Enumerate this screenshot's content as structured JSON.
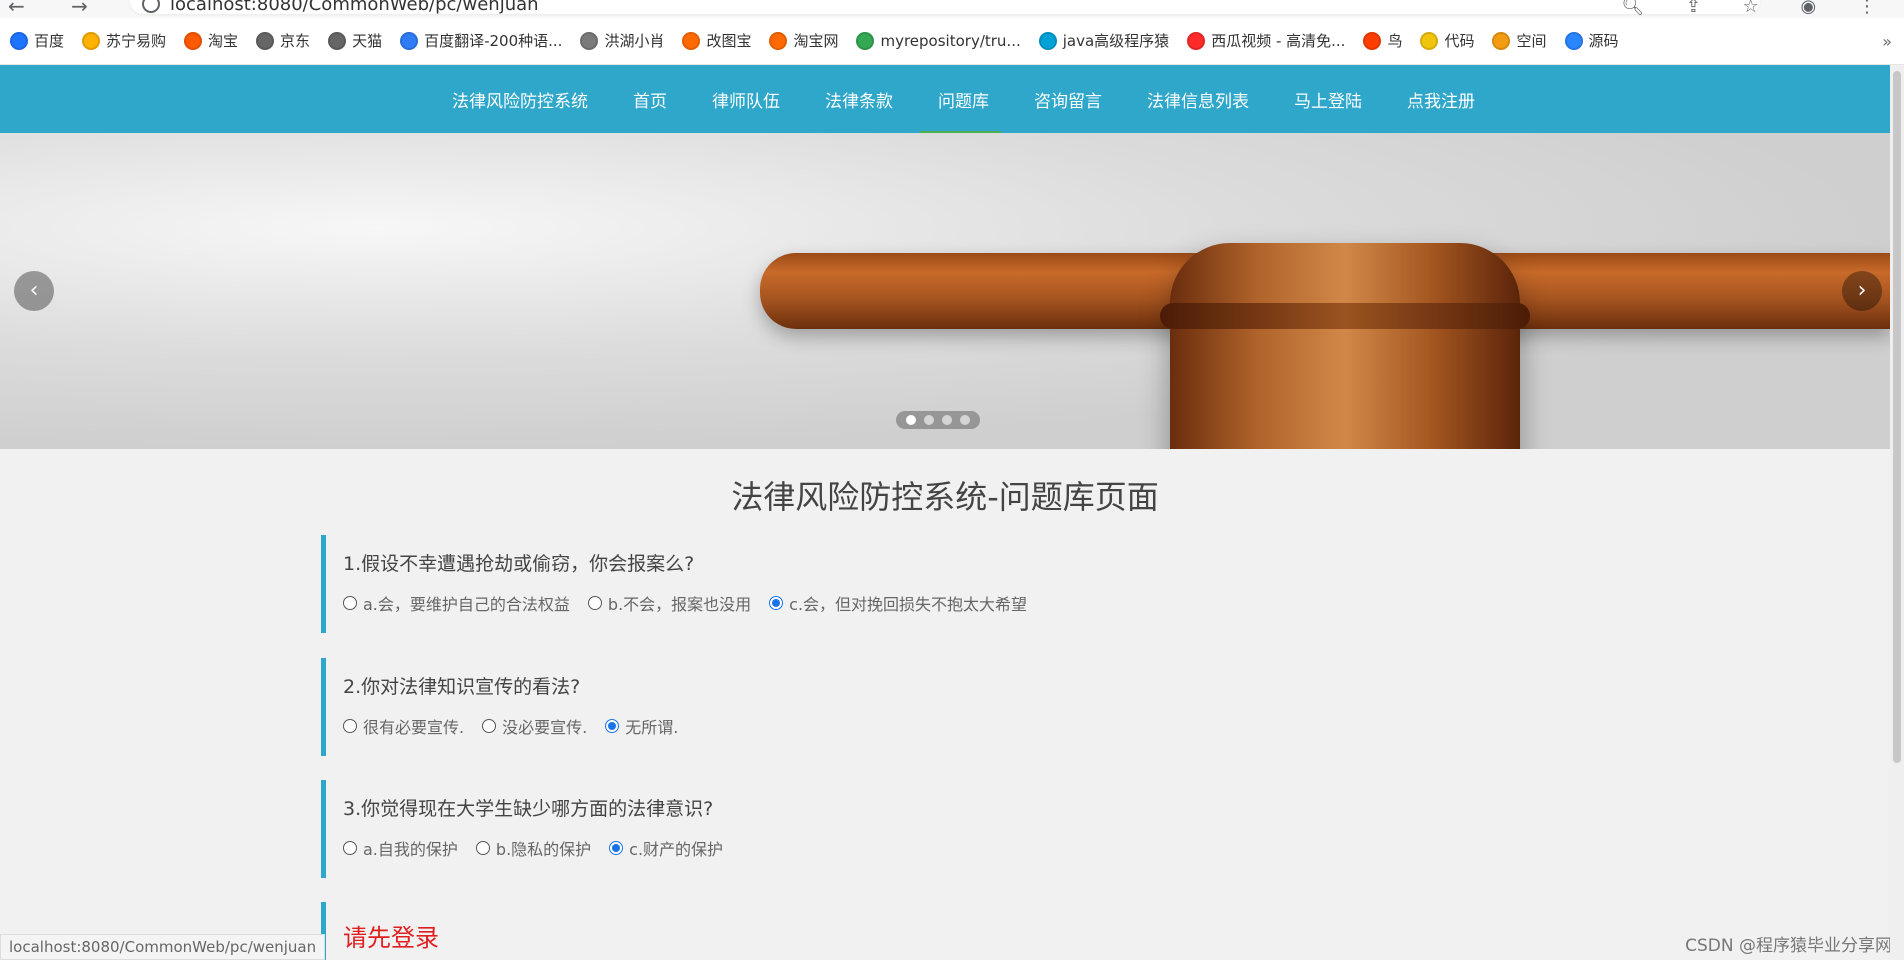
{
  "browser": {
    "url": "localhost:8080/CommonWeb/pc/wenjuan"
  },
  "bookmarks": [
    {
      "label": "百度",
      "color": "#1e73ff"
    },
    {
      "label": "苏宁易购",
      "color": "#ffb100"
    },
    {
      "label": "淘宝",
      "color": "#ff5a00"
    },
    {
      "label": "京东",
      "color": "#666666"
    },
    {
      "label": "天猫",
      "color": "#666666"
    },
    {
      "label": "百度翻译-200种语...",
      "color": "#2f7cf6"
    },
    {
      "label": "洪湖小肖",
      "color": "#7a7a7a"
    },
    {
      "label": "改图宝",
      "color": "#ff6a00"
    },
    {
      "label": "淘宝网",
      "color": "#ff6a00"
    },
    {
      "label": "myrepository/tru...",
      "color": "#34a853"
    },
    {
      "label": "java高级程序猿",
      "color": "#00a1d6"
    },
    {
      "label": "西瓜视频 - 高清免...",
      "color": "#ff2b2b"
    },
    {
      "label": "鸟",
      "color": "#ff3d00"
    },
    {
      "label": "代码",
      "color": "#f1c40f"
    },
    {
      "label": "空间",
      "color": "#f39c12"
    },
    {
      "label": "源码",
      "color": "#2a86ff"
    }
  ],
  "nav": {
    "items": [
      "法律风险防控系统",
      "首页",
      "律师队伍",
      "法律条款",
      "问题库",
      "咨询留言",
      "法律信息列表",
      "马上登陆",
      "点我注册"
    ],
    "active": "问题库",
    "accent": "#2ea7cb",
    "active_underline": "#4caf50"
  },
  "carousel": {
    "dots": 4,
    "active_dot": 1
  },
  "page": {
    "title": "法律风险防控系统-问题库页面"
  },
  "questions": [
    {
      "text": "1.假设不幸遭遇抢劫或偷窃，你会报案么?",
      "options": [
        "a.会，要维护自己的合法权益",
        "b.不会，报案也没用",
        "c.会，但对挽回损失不抱太大希望"
      ],
      "selected": 2
    },
    {
      "text": "2.你对法律知识宣传的看法?",
      "options": [
        "很有必要宣传.",
        "没必要宣传.",
        "无所谓."
      ],
      "selected": 2
    },
    {
      "text": "3.你觉得现在大学生缺少哪方面的法律意识?",
      "options": [
        "a.自我的保护",
        "b.隐私的保护",
        "c.财产的保护"
      ],
      "selected": 2
    }
  ],
  "login_prompt": "请先登录",
  "status_url": "localhost:8080/CommonWeb/pc/wenjuan",
  "watermark": "CSDN @程序猿毕业分享网",
  "icons": {
    "info": "info-icon",
    "back": "back-icon",
    "forward": "forward-icon",
    "reload": "reload-icon",
    "search": "search-icon",
    "share": "share-icon",
    "star": "star-icon",
    "profile": "profile-icon",
    "menu": "menu-icon",
    "prev": "chevron-left-icon",
    "next": "chevron-right-icon"
  }
}
